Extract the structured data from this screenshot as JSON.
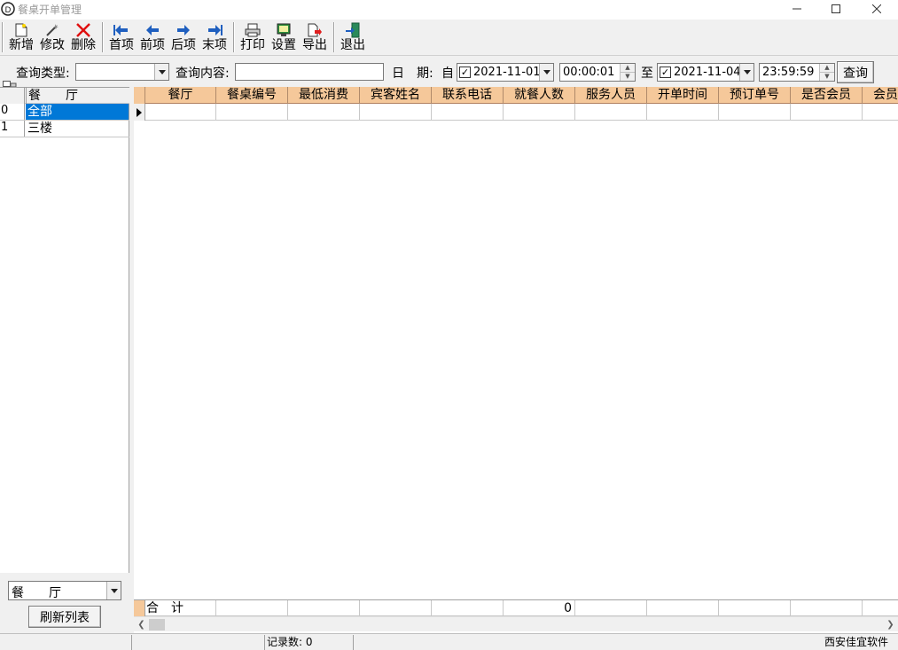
{
  "window": {
    "title": "餐桌开单管理",
    "minimize_icon": "minimize-icon",
    "maximize_icon": "maximize-icon",
    "close_icon": "close-icon"
  },
  "toolbar": {
    "buttons": [
      {
        "label": "新增",
        "icon": "new-document-icon"
      },
      {
        "label": "修改",
        "icon": "edit-wand-icon"
      },
      {
        "label": "删除",
        "icon": "delete-x-icon"
      },
      {
        "label": "首项",
        "icon": "first-arrow-icon"
      },
      {
        "label": "前项",
        "icon": "prev-arrow-icon"
      },
      {
        "label": "后项",
        "icon": "next-arrow-icon"
      },
      {
        "label": "末项",
        "icon": "last-arrow-icon"
      },
      {
        "label": "打印",
        "icon": "printer-icon"
      },
      {
        "label": "设置",
        "icon": "settings-monitor-icon"
      },
      {
        "label": "导出",
        "icon": "export-icon"
      },
      {
        "label": "退出",
        "icon": "exit-door-icon"
      }
    ]
  },
  "query": {
    "type_label": "查询类型:",
    "type_value": "",
    "content_label": "查询内容:",
    "content_value": "",
    "date_label_1": "日",
    "date_label_2": "期:",
    "from_label": "自",
    "from_date": "2021-11-01",
    "from_date_checked": true,
    "from_time": "00:00:01",
    "to_label": "至",
    "to_date": "2021-11-04",
    "to_date_checked": true,
    "to_time": "23:59:59",
    "search_button": "查询"
  },
  "left_panel": {
    "header": "餐　　厅",
    "rows": [
      {
        "index": "0",
        "name": "全部",
        "selected": true
      },
      {
        "index": "1",
        "name": "三楼",
        "selected": false
      }
    ],
    "filter_combo_value": "餐　　厅",
    "refresh_button": "刷新列表"
  },
  "grid": {
    "columns": [
      "餐厅",
      "餐桌编号",
      "最低消费",
      "宾客姓名",
      "联系电话",
      "就餐人数",
      "服务人员",
      "开单时间",
      "预订单号",
      "是否会员",
      "会员"
    ],
    "footer": {
      "label": "合　计",
      "guest_count_total": "0"
    }
  },
  "statusbar": {
    "record_count": "记录数: 0",
    "company": "西安佳宜软件"
  },
  "colors": {
    "header_bg": "#f5c89a",
    "selected_row_bg": "#0078d7",
    "window_bg": "#f0f0f0"
  }
}
